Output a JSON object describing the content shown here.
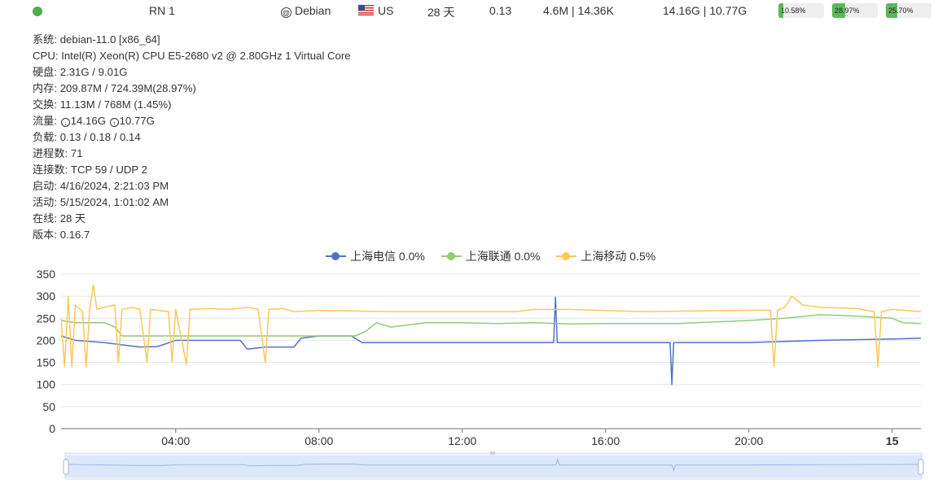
{
  "header": {
    "name": "RN 1",
    "os": "Debian",
    "location": "US",
    "uptime": "28 天",
    "load": "0.13",
    "network_speed": "4.6M | 14.36K",
    "traffic": "14.16G | 10.77G",
    "cpu_percent": "10.58%",
    "mem_percent": "28.97%",
    "disk_percent": "25.70%",
    "cpu_fraction": 0.1058,
    "mem_fraction": 0.2897,
    "disk_fraction": 0.257,
    "status_color": "#4caf50"
  },
  "info": {
    "system_label": "系统:",
    "system": "debian-11.0 [x86_64]",
    "cpu_label": "CPU:",
    "cpu": "Intel(R) Xeon(R) CPU E5-2680 v2 @ 2.80GHz 1 Virtual Core",
    "disk_label": "硬盘:",
    "disk": "2.31G / 9.01G",
    "memory_label": "内存:",
    "memory": "209.87M / 724.39M(28.97%)",
    "swap_label": "交换:",
    "swap": "11.13M / 768M (1.45%)",
    "traffic_label": "流量:",
    "traffic_in": "14.16G",
    "traffic_out": "10.77G",
    "load_label": "负载:",
    "load": "0.13 / 0.18 / 0.14",
    "processes_label": "进程数:",
    "processes": "71",
    "connections_label": "连接数:",
    "connections": "TCP 59 / UDP 2",
    "boot_label": "启动:",
    "boot": "4/16/2024, 2:21:03 PM",
    "active_label": "活动:",
    "active": "5/15/2024, 1:01:02 AM",
    "online_label": "在线:",
    "online": "28 天",
    "version_label": "版本:",
    "version": "0.16.7"
  },
  "chart_data": {
    "type": "line",
    "x_unit": "hour",
    "xlim": [
      0.8,
      24.8
    ],
    "ylim": [
      0,
      350
    ],
    "yticks": [
      0,
      50,
      100,
      150,
      200,
      250,
      300,
      350
    ],
    "ytick_labels": [
      "0",
      "50",
      "100",
      "150",
      "200",
      "250",
      "300",
      "350"
    ],
    "xticks": [
      4,
      8,
      12,
      16,
      20,
      24
    ],
    "xtick_labels": [
      "04:00",
      "08:00",
      "12:00",
      "16:00",
      "20:00",
      "15"
    ],
    "grid": true,
    "legend_position": "top",
    "series": [
      {
        "name": "上海电信",
        "loss": "0.0%",
        "color": "#5470c6",
        "points": [
          [
            0.8,
            210
          ],
          [
            1.2,
            200
          ],
          [
            2,
            195
          ],
          [
            2.5,
            190
          ],
          [
            3,
            185
          ],
          [
            3.5,
            186
          ],
          [
            4,
            200
          ],
          [
            5,
            200
          ],
          [
            5.8,
            200
          ],
          [
            6,
            180
          ],
          [
            6.5,
            185
          ],
          [
            7,
            185
          ],
          [
            7.3,
            185
          ],
          [
            7.5,
            205
          ],
          [
            8,
            210
          ],
          [
            8.9,
            210
          ],
          [
            9.2,
            195
          ],
          [
            10,
            195
          ],
          [
            12,
            195
          ],
          [
            14,
            195
          ],
          [
            14.55,
            195
          ],
          [
            14.6,
            298
          ],
          [
            14.65,
            195
          ],
          [
            16,
            195
          ],
          [
            17.8,
            195
          ],
          [
            17.85,
            100
          ],
          [
            17.9,
            195
          ],
          [
            20,
            195
          ],
          [
            22,
            200
          ],
          [
            24,
            203
          ],
          [
            24.8,
            205
          ]
        ]
      },
      {
        "name": "上海联通",
        "loss": "0.0%",
        "color": "#91cc75",
        "points": [
          [
            0.8,
            245
          ],
          [
            1.2,
            240
          ],
          [
            2,
            240
          ],
          [
            2.3,
            230
          ],
          [
            2.5,
            210
          ],
          [
            4,
            210
          ],
          [
            6,
            210
          ],
          [
            7,
            210
          ],
          [
            8.5,
            210
          ],
          [
            9,
            210
          ],
          [
            9.3,
            220
          ],
          [
            9.6,
            240
          ],
          [
            10,
            230
          ],
          [
            11,
            240
          ],
          [
            12,
            240
          ],
          [
            13,
            238
          ],
          [
            14,
            240
          ],
          [
            15,
            237
          ],
          [
            16,
            238
          ],
          [
            18,
            238
          ],
          [
            20,
            245
          ],
          [
            21,
            250
          ],
          [
            22,
            258
          ],
          [
            23,
            255
          ],
          [
            24,
            250
          ],
          [
            24.3,
            240
          ],
          [
            24.8,
            238
          ]
        ]
      },
      {
        "name": "上海移动",
        "loss": "0.5%",
        "color": "#fac858",
        "points": [
          [
            0.8,
            250
          ],
          [
            0.9,
            140
          ],
          [
            1,
            300
          ],
          [
            1.1,
            140
          ],
          [
            1.2,
            280
          ],
          [
            1.4,
            265
          ],
          [
            1.5,
            140
          ],
          [
            1.6,
            270
          ],
          [
            1.7,
            325
          ],
          [
            1.8,
            270
          ],
          [
            2,
            275
          ],
          [
            2.3,
            280
          ],
          [
            2.4,
            150
          ],
          [
            2.5,
            270
          ],
          [
            2.8,
            275
          ],
          [
            3,
            270
          ],
          [
            3.2,
            150
          ],
          [
            3.3,
            270
          ],
          [
            3.8,
            265
          ],
          [
            3.9,
            150
          ],
          [
            4,
            270
          ],
          [
            4.3,
            145
          ],
          [
            4.4,
            270
          ],
          [
            5,
            272
          ],
          [
            5.5,
            270
          ],
          [
            6,
            275
          ],
          [
            6.3,
            270
          ],
          [
            6.5,
            150
          ],
          [
            6.6,
            270
          ],
          [
            7,
            272
          ],
          [
            7.3,
            265
          ],
          [
            8,
            268
          ],
          [
            10,
            265
          ],
          [
            12,
            265
          ],
          [
            13.5,
            265
          ],
          [
            14,
            270
          ],
          [
            15,
            270
          ],
          [
            17,
            265
          ],
          [
            20,
            268
          ],
          [
            20.6,
            268
          ],
          [
            20.7,
            140
          ],
          [
            20.8,
            268
          ],
          [
            21,
            275
          ],
          [
            21.2,
            300
          ],
          [
            21.5,
            280
          ],
          [
            22,
            275
          ],
          [
            23,
            272
          ],
          [
            23.5,
            265
          ],
          [
            23.6,
            140
          ],
          [
            23.7,
            265
          ],
          [
            24,
            270
          ],
          [
            24.8,
            265
          ]
        ]
      }
    ]
  }
}
